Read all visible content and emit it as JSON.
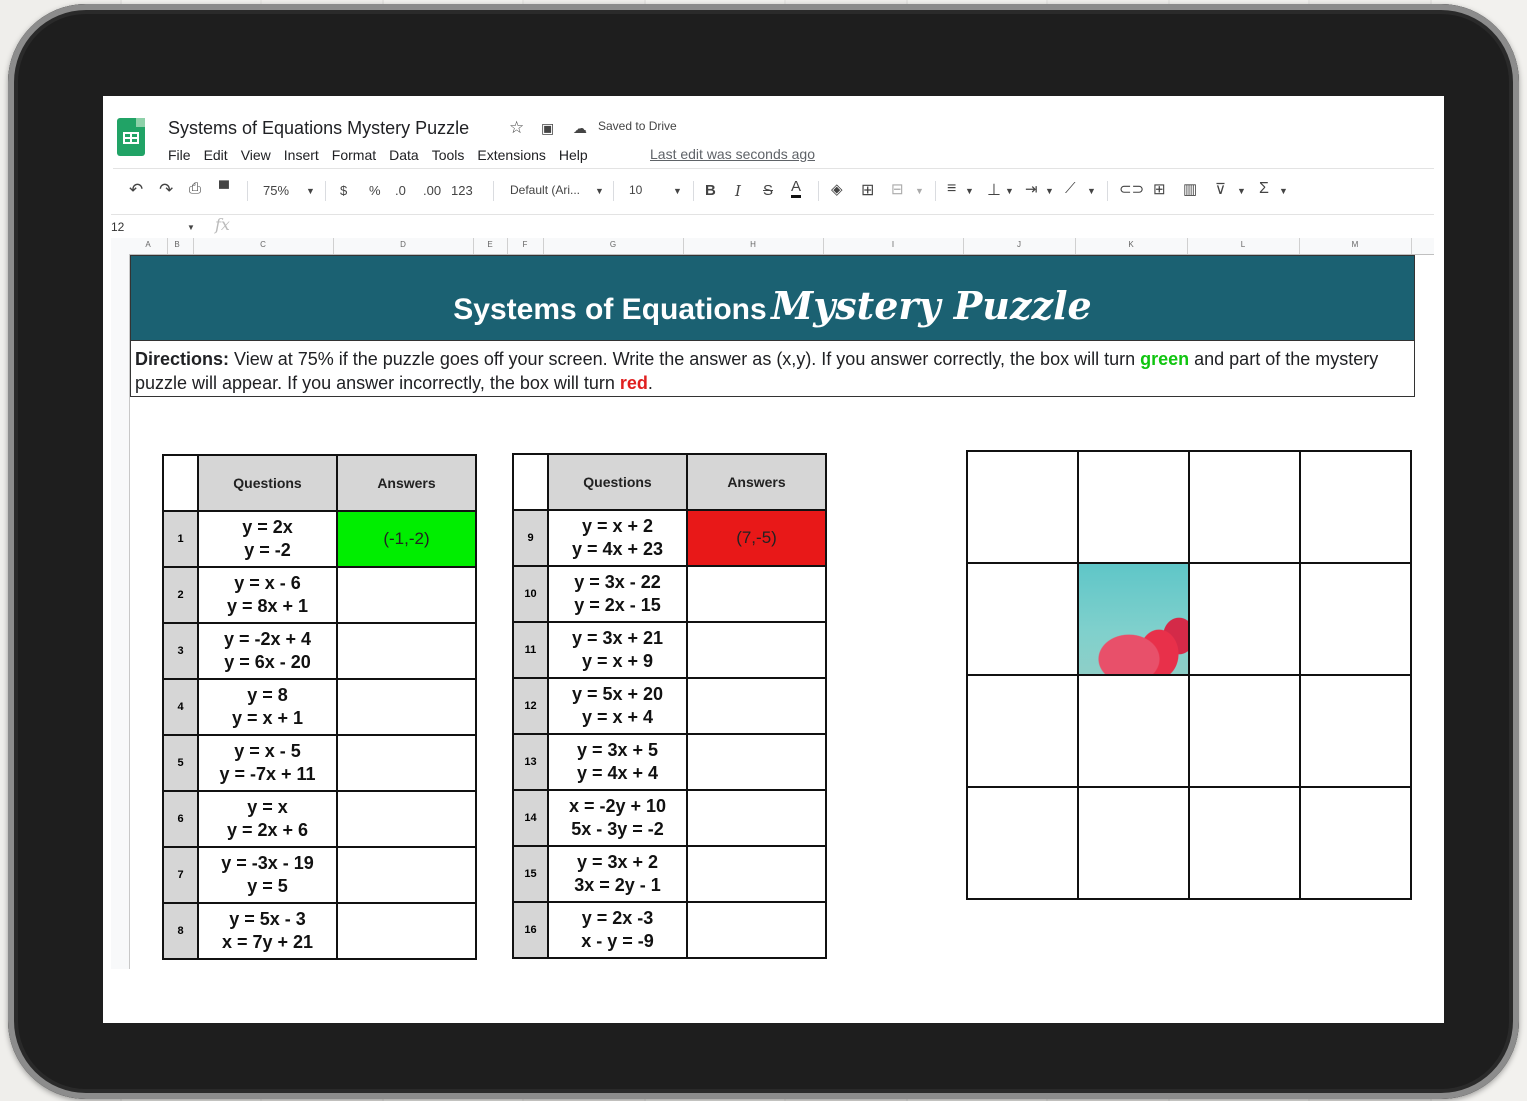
{
  "app": {
    "doc_title": "Systems of Equations Mystery Puzzle",
    "saved_status": "Saved to Drive",
    "last_edit": "Last edit was seconds ago",
    "menu": [
      "File",
      "Edit",
      "View",
      "Insert",
      "Format",
      "Data",
      "Tools",
      "Extensions",
      "Help"
    ]
  },
  "toolbar": {
    "zoom": "75%",
    "currency": "$",
    "percent": "%",
    "dec_decrease": ".0",
    "dec_increase": ".00",
    "more_formats": "123",
    "font": "Default (Ari...",
    "font_size": "10",
    "bold": "B",
    "italic": "I",
    "strike": "S",
    "text_color": "A"
  },
  "formula_bar": {
    "name_box": "12",
    "fx": "fx"
  },
  "columns": [
    "A",
    "B",
    "C",
    "D",
    "E",
    "F",
    "G",
    "H",
    "I",
    "J",
    "K",
    "L",
    "M"
  ],
  "banner": {
    "title_plain": "Systems of Equations",
    "title_script": "Mystery Puzzle",
    "color": "#1b6172"
  },
  "directions": {
    "label": "Directions:",
    "text1": " View at 75% if the puzzle goes off your screen. Write the answer as (x,y). If you answer correctly, the box will turn ",
    "green_word": "green",
    "text2": " and part of the mystery puzzle will appear. If you answer incorrectly, the box will turn ",
    "red_word": "red",
    "text3": "."
  },
  "table_headers": {
    "questions": "Questions",
    "answers": "Answers"
  },
  "questions_left": [
    {
      "n": "1",
      "eq1": "y = 2x",
      "eq2": "y = -2",
      "answer": "(-1,-2)",
      "status": "correct"
    },
    {
      "n": "2",
      "eq1": "y = x - 6",
      "eq2": "y = 8x + 1",
      "answer": "",
      "status": ""
    },
    {
      "n": "3",
      "eq1": "y = -2x + 4",
      "eq2": "y = 6x - 20",
      "answer": "",
      "status": ""
    },
    {
      "n": "4",
      "eq1": "y = 8",
      "eq2": "y = x + 1",
      "answer": "",
      "status": ""
    },
    {
      "n": "5",
      "eq1": "y = x - 5",
      "eq2": "y = -7x + 11",
      "answer": "",
      "status": ""
    },
    {
      "n": "6",
      "eq1": "y = x",
      "eq2": "y = 2x + 6",
      "answer": "",
      "status": ""
    },
    {
      "n": "7",
      "eq1": "y = -3x - 19",
      "eq2": "y = 5",
      "answer": "",
      "status": ""
    },
    {
      "n": "8",
      "eq1": "y = 5x - 3",
      "eq2": "x = 7y + 21",
      "answer": "",
      "status": ""
    }
  ],
  "questions_right": [
    {
      "n": "9",
      "eq1": "y = x + 2",
      "eq2": "y = 4x + 23",
      "answer": "(7,-5)",
      "status": "incorrect"
    },
    {
      "n": "10",
      "eq1": "y = 3x - 22",
      "eq2": "y = 2x - 15",
      "answer": "",
      "status": ""
    },
    {
      "n": "11",
      "eq1": "y = 3x + 21",
      "eq2": "y = x + 9",
      "answer": "",
      "status": ""
    },
    {
      "n": "12",
      "eq1": "y = 5x + 20",
      "eq2": "y = x + 4",
      "answer": "",
      "status": ""
    },
    {
      "n": "13",
      "eq1": "y = 3x + 5",
      "eq2": "y = 4x + 4",
      "answer": "",
      "status": ""
    },
    {
      "n": "14",
      "eq1": "x = -2y + 10",
      "eq2": "5x - 3y = -2",
      "answer": "",
      "status": ""
    },
    {
      "n": "15",
      "eq1": "y = 3x + 2",
      "eq2": "3x = 2y - 1",
      "answer": "",
      "status": ""
    },
    {
      "n": "16",
      "eq1": "y = 2x -3",
      "eq2": "x - y = -9",
      "answer": "",
      "status": ""
    }
  ],
  "puzzle": {
    "rows": 4,
    "cols": 4,
    "revealed": [
      [
        1,
        1
      ]
    ]
  },
  "colors": {
    "correct": "#00ee00",
    "incorrect": "#e81818",
    "header_gray": "#d6d6d6"
  }
}
